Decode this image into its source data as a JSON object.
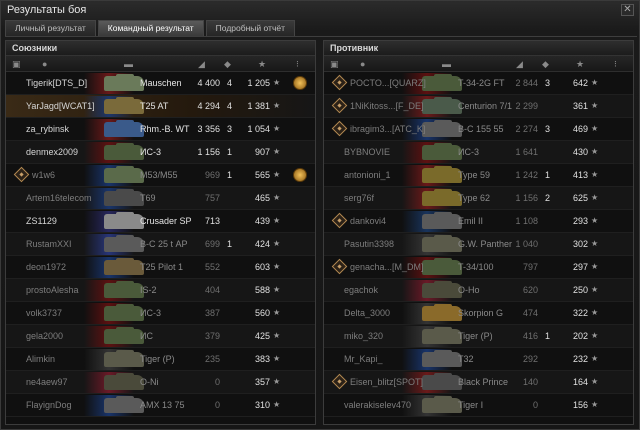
{
  "window": {
    "title": "Результаты боя",
    "close_glyph": "✕"
  },
  "tabs": [
    {
      "label": "Личный результат",
      "active": false
    },
    {
      "label": "Командный результат",
      "active": true
    },
    {
      "label": "Подробный отчёт",
      "active": false
    }
  ],
  "allies": {
    "title": "Союзники",
    "rows": [
      {
        "player": "Tigerik[DTS_D]",
        "tank": "Mauschen",
        "dmg": "4 400",
        "kills": "4",
        "xp": "1 205",
        "alive": true,
        "clan": false,
        "medal": true,
        "self": false,
        "flag": "#7a1a1a",
        "tank_color": "#6a7a5a"
      },
      {
        "player": "YarJagd[WCAT1]",
        "tank": "T25 AT",
        "dmg": "4 294",
        "kills": "4",
        "xp": "1 381",
        "alive": true,
        "clan": false,
        "medal": false,
        "self": true,
        "flag": "#1a3a7a",
        "tank_color": "#7a6a3a"
      },
      {
        "player": "za_rybinsk",
        "tank": "Rhm.-B. WT",
        "dmg": "3 356",
        "kills": "3",
        "xp": "1 054",
        "alive": true,
        "clan": false,
        "medal": false,
        "self": false,
        "flag": "#7a1a1a",
        "tank_color": "#3a5a8a"
      },
      {
        "player": "denmex2009",
        "tank": "ИС-3",
        "dmg": "1 156",
        "kills": "1",
        "xp": "907",
        "alive": true,
        "clan": false,
        "medal": false,
        "self": false,
        "flag": "#6a1010",
        "tank_color": "#4a5a3a"
      },
      {
        "player": "w1w6",
        "tank": "M53/M55",
        "dmg": "969",
        "kills": "1",
        "xp": "565",
        "alive": false,
        "clan": true,
        "medal": true,
        "self": false,
        "flag": "#1a3a7a",
        "tank_color": "#5a6a4a"
      },
      {
        "player": "Artem16telecom",
        "tank": "T69",
        "dmg": "757",
        "kills": "",
        "xp": "465",
        "alive": false,
        "clan": false,
        "medal": false,
        "self": false,
        "flag": "#1a3a7a",
        "tank_color": "#4a4a4a"
      },
      {
        "player": "ZS1129",
        "tank": "Crusader SP",
        "dmg": "713",
        "kills": "",
        "xp": "439",
        "alive": true,
        "clan": false,
        "medal": false,
        "self": false,
        "flag": "#2a2a6a",
        "tank_color": "#8a8a8a"
      },
      {
        "player": "RustamXXI",
        "tank": "В-С 25 t АР",
        "dmg": "699",
        "kills": "1",
        "xp": "424",
        "alive": false,
        "clan": false,
        "medal": false,
        "self": false,
        "flag": "#2a3a8a",
        "tank_color": "#5a5a5a"
      },
      {
        "player": "deon1972",
        "tank": "T25 Pilot 1",
        "dmg": "552",
        "kills": "",
        "xp": "603",
        "alive": false,
        "clan": false,
        "medal": false,
        "self": false,
        "flag": "#1a3a7a",
        "tank_color": "#6a5a3a"
      },
      {
        "player": "prostoAlesha",
        "tank": "IS-2",
        "dmg": "404",
        "kills": "",
        "xp": "588",
        "alive": false,
        "clan": false,
        "medal": false,
        "self": false,
        "flag": "#6a1010",
        "tank_color": "#4a5a3a"
      },
      {
        "player": "volk3737",
        "tank": "ИС-3",
        "dmg": "387",
        "kills": "",
        "xp": "560",
        "alive": false,
        "clan": false,
        "medal": false,
        "self": false,
        "flag": "#6a1010",
        "tank_color": "#4a5a3a"
      },
      {
        "player": "gela2000",
        "tank": "ИС",
        "dmg": "379",
        "kills": "",
        "xp": "425",
        "alive": false,
        "clan": false,
        "medal": false,
        "self": false,
        "flag": "#6a1010",
        "tank_color": "#4a5a3a"
      },
      {
        "player": "Alimkin",
        "tank": "Tiger (P)",
        "dmg": "235",
        "kills": "",
        "xp": "383",
        "alive": false,
        "clan": false,
        "medal": false,
        "self": false,
        "flag": "#3a3a3a",
        "tank_color": "#5a5a4a"
      },
      {
        "player": "ne4aew97",
        "tank": "O-Ni",
        "dmg": "0",
        "kills": "",
        "xp": "357",
        "alive": false,
        "clan": false,
        "medal": false,
        "self": false,
        "flag": "#7a1a2a",
        "tank_color": "#4a4a3a"
      },
      {
        "player": "FlayignDog",
        "tank": "AMX 13 75",
        "dmg": "0",
        "kills": "",
        "xp": "310",
        "alive": false,
        "clan": false,
        "medal": false,
        "self": false,
        "flag": "#1a3a7a",
        "tank_color": "#5a5a5a"
      }
    ]
  },
  "enemies": {
    "title": "Противник",
    "rows": [
      {
        "player": "POCTO...[QUARZ]",
        "tank": "T-34-2G FT",
        "dmg": "2 844",
        "kills": "3",
        "xp": "642",
        "alive": false,
        "clan": true,
        "flag": "#6a1010",
        "tank_color": "#4a5a3a"
      },
      {
        "player": "1NiKitoss...[F_DE]",
        "tank": "Centurion 7/1",
        "dmg": "2 299",
        "kills": "",
        "xp": "361",
        "alive": false,
        "clan": true,
        "flag": "#7a1a1a",
        "tank_color": "#4a5a4a"
      },
      {
        "player": "ibragim3...[ATC_K]",
        "tank": "В-С 155 55",
        "dmg": "2 274",
        "kills": "3",
        "xp": "469",
        "alive": false,
        "clan": true,
        "flag": "#1a3a7a",
        "tank_color": "#5a5a5a"
      },
      {
        "player": "BYBNOVIE",
        "tank": "ИС-3",
        "dmg": "1 641",
        "kills": "",
        "xp": "430",
        "alive": false,
        "clan": false,
        "flag": "#6a1010",
        "tank_color": "#4a5a3a"
      },
      {
        "player": "antonioni_1",
        "tank": "Type 59",
        "dmg": "1 242",
        "kills": "1",
        "xp": "413",
        "alive": false,
        "clan": false,
        "flag": "#7a1a1a",
        "tank_color": "#7a6a2a"
      },
      {
        "player": "serg76f",
        "tank": "Type 62",
        "dmg": "1 156",
        "kills": "2",
        "xp": "625",
        "alive": false,
        "clan": false,
        "flag": "#7a1a1a",
        "tank_color": "#7a6a2a"
      },
      {
        "player": "dankovi4",
        "tank": "Emil II",
        "dmg": "1 108",
        "kills": "",
        "xp": "293",
        "alive": false,
        "clan": true,
        "flag": "#1a3a6a",
        "tank_color": "#5a5a5a"
      },
      {
        "player": "Pasutin3398",
        "tank": "G.W. Panther",
        "dmg": "1 040",
        "kills": "",
        "xp": "302",
        "alive": false,
        "clan": false,
        "flag": "#3a3a3a",
        "tank_color": "#5a5a4a"
      },
      {
        "player": "genacha...[M_DM]",
        "tank": "T-34/100",
        "dmg": "797",
        "kills": "",
        "xp": "297",
        "alive": false,
        "clan": true,
        "flag": "#6a1010",
        "tank_color": "#4a5a3a"
      },
      {
        "player": "egachok",
        "tank": "O-Ho",
        "dmg": "620",
        "kills": "",
        "xp": "250",
        "alive": false,
        "clan": false,
        "flag": "#7a1a2a",
        "tank_color": "#4a4a3a"
      },
      {
        "player": "Delta_3000",
        "tank": "Skorpion G",
        "dmg": "474",
        "kills": "",
        "xp": "322",
        "alive": false,
        "clan": false,
        "flag": "#3a3a3a",
        "tank_color": "#8a6a2a"
      },
      {
        "player": "miko_320",
        "tank": "Tiger (P)",
        "dmg": "416",
        "kills": "1",
        "xp": "202",
        "alive": false,
        "clan": false,
        "flag": "#3a3a3a",
        "tank_color": "#5a5a4a"
      },
      {
        "player": "Mr_Kapi_",
        "tank": "T32",
        "dmg": "292",
        "kills": "",
        "xp": "232",
        "alive": false,
        "clan": false,
        "flag": "#1a3a7a",
        "tank_color": "#5a5a5a"
      },
      {
        "player": "Eisen_blitz[SPOT]",
        "tank": "Black Prince",
        "dmg": "140",
        "kills": "",
        "xp": "164",
        "alive": false,
        "clan": true,
        "flag": "#7a1a1a",
        "tank_color": "#4a4a4a"
      },
      {
        "player": "valerakiselev470",
        "tank": "Tiger I",
        "dmg": "0",
        "kills": "",
        "xp": "156",
        "alive": false,
        "clan": false,
        "flag": "#3a3a3a",
        "tank_color": "#5a5a4a"
      }
    ]
  },
  "header_icons": [
    "squad-icon",
    "player-icon",
    "tank-icon",
    "damage-icon",
    "kills-icon",
    "xp-icon",
    "medal-icon"
  ]
}
